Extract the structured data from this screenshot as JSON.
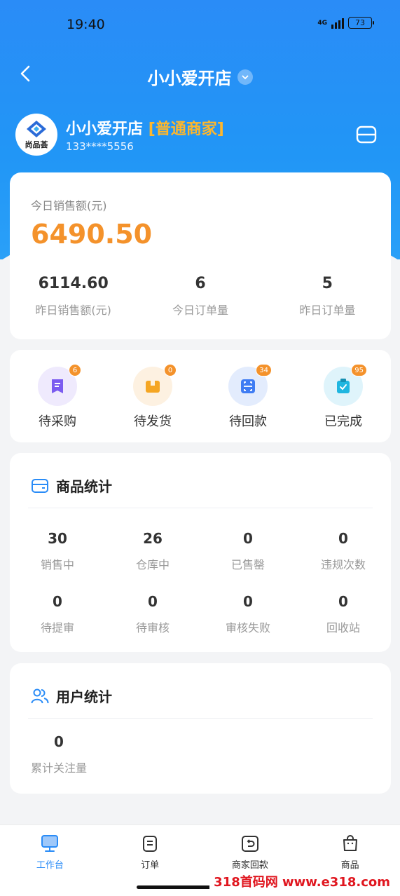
{
  "status": {
    "time": "19:40",
    "network": "4G",
    "battery": "73"
  },
  "header": {
    "title": "小小爱开店"
  },
  "profile": {
    "avatar_text": "尚品荟",
    "name": "小小爱开店",
    "tag": "[普通商家]",
    "phone": "133****5556"
  },
  "sales": {
    "today_label": "今日销售额(元)",
    "today_value": "6490.50",
    "stats": [
      {
        "value": "6114.60",
        "label": "昨日销售额(元)"
      },
      {
        "value": "6",
        "label": "今日订单量"
      },
      {
        "value": "5",
        "label": "昨日订单量"
      }
    ]
  },
  "orders": [
    {
      "label": "待采购",
      "badge": "6",
      "icon": "receipt-icon",
      "color": "#7b5cf0",
      "bg": "#efeafd"
    },
    {
      "label": "待发货",
      "badge": "0",
      "icon": "box-icon",
      "color": "#f5a623",
      "bg": "#fdf1e1"
    },
    {
      "label": "待回款",
      "badge": "34",
      "icon": "scan-icon",
      "color": "#3f7cf3",
      "bg": "#e3ecfd"
    },
    {
      "label": "已完成",
      "badge": "95",
      "icon": "clipboard-check-icon",
      "color": "#1fb6e0",
      "bg": "#dff4fb"
    }
  ],
  "goods": {
    "title": "商品统计",
    "stats": [
      {
        "value": "30",
        "label": "销售中"
      },
      {
        "value": "26",
        "label": "仓库中"
      },
      {
        "value": "0",
        "label": "已售罄"
      },
      {
        "value": "0",
        "label": "违规次数"
      },
      {
        "value": "0",
        "label": "待提审"
      },
      {
        "value": "0",
        "label": "待审核"
      },
      {
        "value": "0",
        "label": "审核失败"
      },
      {
        "value": "0",
        "label": "回收站"
      }
    ]
  },
  "users": {
    "title": "用户统计",
    "stats": [
      {
        "value": "0",
        "label": "累计关注量"
      }
    ]
  },
  "tabs": [
    {
      "label": "工作台",
      "icon": "monitor-icon",
      "active": true
    },
    {
      "label": "订单",
      "icon": "order-icon",
      "active": false
    },
    {
      "label": "商家回款",
      "icon": "refund-icon",
      "active": false
    },
    {
      "label": "商品",
      "icon": "bag-icon",
      "active": false
    }
  ],
  "watermark": "318首码网 www.e318.com",
  "colors": {
    "primary": "#2a8cf7",
    "accent": "#f4922b",
    "tag": "#ffb72b"
  }
}
